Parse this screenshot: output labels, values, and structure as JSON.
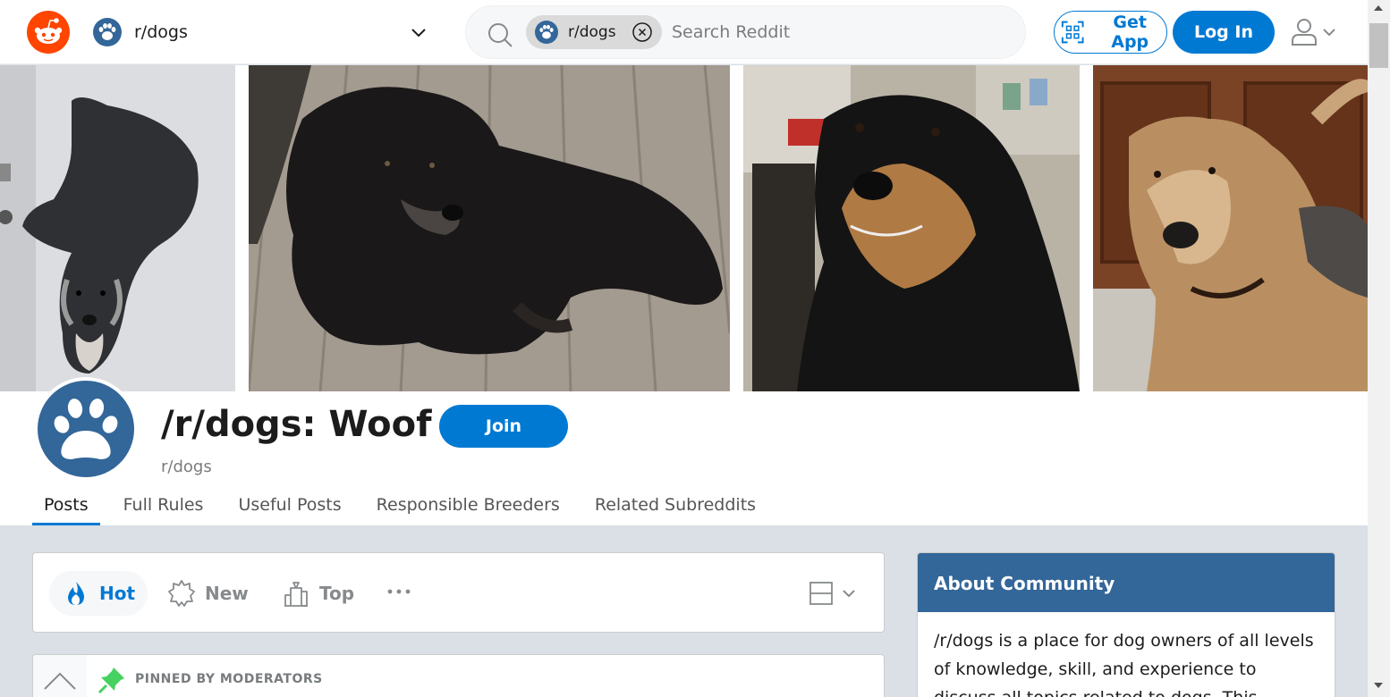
{
  "header": {
    "community_name": "r/dogs",
    "search": {
      "chip_label": "r/dogs",
      "placeholder": "Search Reddit",
      "value": ""
    },
    "get_app_label": "Get App",
    "login_label": "Log In"
  },
  "banner": {
    "photos": [
      "schnauzer-photo",
      "black-dog-on-deck-photo",
      "black-and-tan-dog-photo",
      "tan-dog-photo"
    ]
  },
  "community": {
    "title": "/r/dogs: Woof",
    "subreddit": "r/dogs",
    "join_label": "Join",
    "tabs": [
      {
        "label": "Posts",
        "active": true
      },
      {
        "label": "Full Rules",
        "active": false
      },
      {
        "label": "Useful Posts",
        "active": false
      },
      {
        "label": "Responsible Breeders",
        "active": false
      },
      {
        "label": "Related Subreddits",
        "active": false
      }
    ]
  },
  "sort": {
    "options": [
      {
        "label": "Hot",
        "icon": "flame-icon",
        "active": true
      },
      {
        "label": "New",
        "icon": "burst-icon",
        "active": false
      },
      {
        "label": "Top",
        "icon": "chart-up-icon",
        "active": false
      }
    ]
  },
  "post": {
    "pinned_label": "PINNED BY MODERATORS"
  },
  "about": {
    "heading": "About Community",
    "description": "/r/dogs is a place for dog owners of all levels of knowledge, skill, and experience to discuss all topics related to dogs. This"
  },
  "colors": {
    "accent": "#0079d3",
    "community": "#336699",
    "reddit_orange": "#ff4500"
  }
}
